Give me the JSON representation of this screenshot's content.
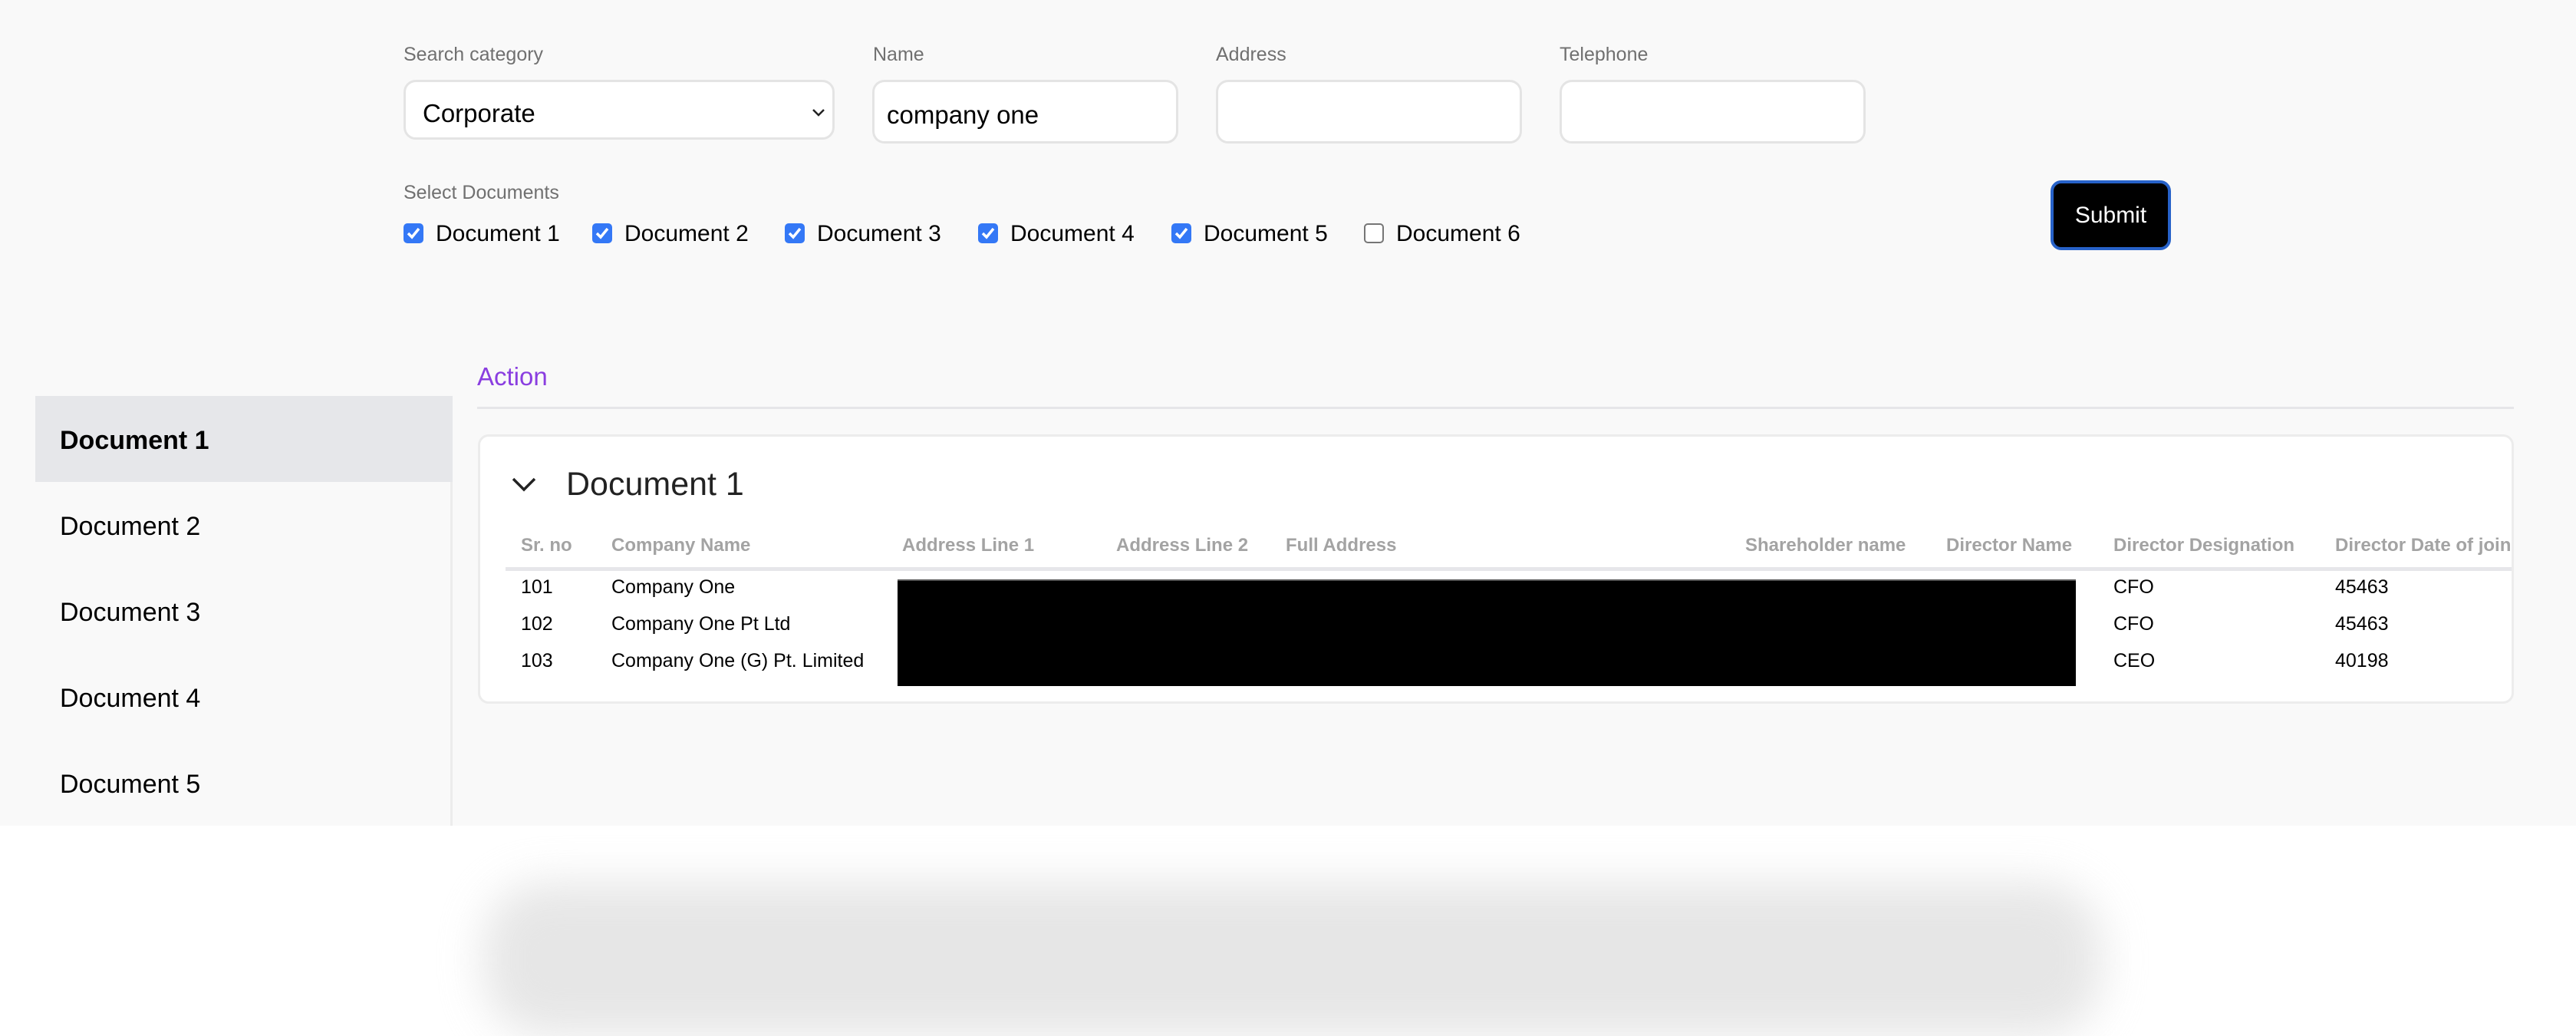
{
  "search_form": {
    "category": {
      "label": "Search category",
      "value": "Corporate"
    },
    "name": {
      "label": "Name",
      "value": "company one",
      "placeholder": ""
    },
    "address": {
      "label": "Address",
      "value": "",
      "placeholder": ""
    },
    "telephone": {
      "label": "Telephone",
      "value": "",
      "placeholder": ""
    },
    "documents": {
      "label": "Select Documents",
      "items": [
        {
          "label": "Document 1",
          "checked": true
        },
        {
          "label": "Document 2",
          "checked": true
        },
        {
          "label": "Document 3",
          "checked": true
        },
        {
          "label": "Document 4",
          "checked": true
        },
        {
          "label": "Document 5",
          "checked": true
        },
        {
          "label": "Document 6",
          "checked": false
        }
      ]
    },
    "submit_label": "Submit"
  },
  "sidebar": {
    "items": [
      {
        "label": "Document 1",
        "active": true
      },
      {
        "label": "Document 2",
        "active": false
      },
      {
        "label": "Document 3",
        "active": false
      },
      {
        "label": "Document 4",
        "active": false
      },
      {
        "label": "Document 5",
        "active": false
      }
    ]
  },
  "main": {
    "tab_label": "Action",
    "panel": {
      "title": "Document 1",
      "expanded": true,
      "columns": [
        "Sr. no",
        "Company Name",
        "Address Line 1",
        "Address Line 2",
        "Full Address",
        "Shareholder name",
        "Director Name",
        "Director Designation",
        "Director Date of joini"
      ],
      "rows": [
        {
          "sr_no": "101",
          "company_name": "Company One",
          "director_designation": "CFO",
          "director_date_of_joining": "45463"
        },
        {
          "sr_no": "102",
          "company_name": "Company One Pt Ltd",
          "director_designation": "CFO",
          "director_date_of_joining": "45463"
        },
        {
          "sr_no": "103",
          "company_name": "Company One (G) Pt. Limited",
          "director_designation": "CEO",
          "director_date_of_joining": "40198"
        }
      ],
      "redacted_columns": [
        "Address Line 1",
        "Address Line 2",
        "Full Address",
        "Shareholder name",
        "Director Name"
      ]
    }
  },
  "colors": {
    "accent": "#8a3ee0",
    "checkbox": "#3478f6",
    "submit_bg": "#000000",
    "submit_ring": "#2762c9"
  }
}
